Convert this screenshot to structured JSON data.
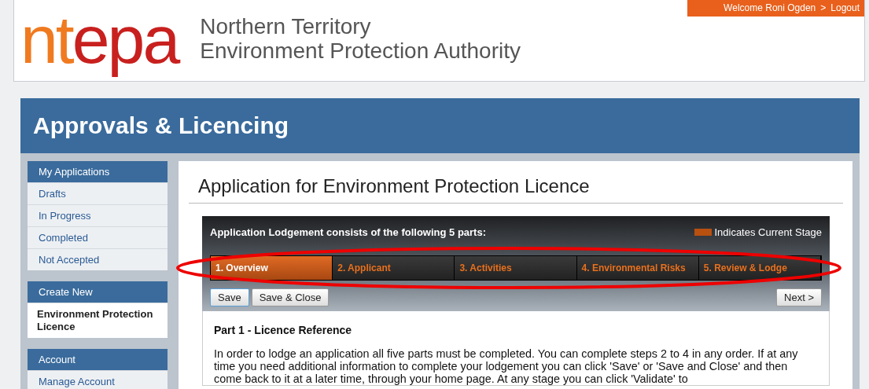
{
  "header": {
    "logo": {
      "part_1": "nt",
      "part_2": "epa"
    },
    "org_name": [
      "Northern Territory",
      "Environment Protection Authority"
    ],
    "user_bar": {
      "welcome": "Welcome Roni Ogden",
      "separator": ">",
      "logout": "Logout"
    }
  },
  "banner": {
    "title": "Approvals & Licencing"
  },
  "sidebar": [
    {
      "heading": "My Applications",
      "items": [
        {
          "label": "Drafts",
          "selected": false
        },
        {
          "label": "In Progress",
          "selected": false
        },
        {
          "label": "Completed",
          "selected": false
        },
        {
          "label": "Not Accepted",
          "selected": false
        }
      ]
    },
    {
      "heading": "Create New",
      "items": [
        {
          "label": "Environment Protection Licence",
          "selected": true
        }
      ]
    },
    {
      "heading": "Account",
      "items": [
        {
          "label": "Manage Account",
          "selected": false
        }
      ]
    }
  ],
  "page_title": "Application for Environment Protection Licence",
  "stages": {
    "intro": "Application Lodgement consists of the following 5 parts:",
    "legend": "Indicates Current Stage",
    "tabs": [
      {
        "label": "1. Overview",
        "selected": true
      },
      {
        "label": "2. Applicant",
        "selected": false
      },
      {
        "label": "3. Activities",
        "selected": false
      },
      {
        "label": "4. Environmental Risks",
        "selected": false
      },
      {
        "label": "5. Review & Lodge",
        "selected": false
      }
    ],
    "buttons": [
      {
        "label": "Save",
        "kind": "focused"
      },
      {
        "label": "Save & Close",
        "kind": "normal"
      }
    ],
    "next_button": "Next >"
  },
  "section": {
    "heading": "Part 1 - Licence Reference",
    "paragraph": "In order to lodge an application all five parts must be completed. You can complete steps 2 to 4 in any order. If at any time you need additional information to complete your lodgement you can click 'Save' or 'Save and Close' and then come back to it at a later time, through your home page. At any stage you can click 'Validate' to"
  },
  "annotation": {
    "kind": "ellipse"
  }
}
